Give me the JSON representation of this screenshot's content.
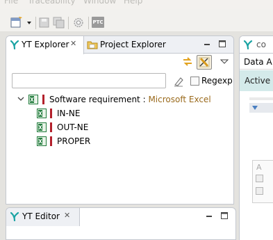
{
  "menubar": {
    "items": [
      "File",
      "Traceability",
      "Window",
      "Help"
    ]
  },
  "toolbar": {
    "icons": [
      "new-wizard-icon",
      "dropdown-arrow-icon",
      "save-icon",
      "save-all-icon",
      "gear-icon",
      "ptc-icon"
    ],
    "ptc_label": "PTC"
  },
  "explorer": {
    "tabs": [
      {
        "label": "YT Explorer",
        "active": true
      },
      {
        "label": "Project Explorer",
        "active": false
      }
    ],
    "filter": {
      "value": "",
      "regexp_label": "Regexp",
      "regexp_checked": false
    },
    "tree": {
      "root": {
        "label": "Software requirement",
        "separator": " : ",
        "type_label": "Microsoft Excel",
        "expanded": true
      },
      "children": [
        "IN-NE",
        "OUT-NE",
        "PROPER"
      ]
    }
  },
  "rightpanel": {
    "tab_label": "co",
    "header": "Data A",
    "active_label": "Active",
    "col_header": "A"
  },
  "editor": {
    "tab_label": "YT Editor"
  },
  "colors": {
    "accent": "#1aa3a3",
    "excel_green": "#1f7a3a",
    "type_brown": "#9a6a1c",
    "red_marker": "#b3202b"
  }
}
